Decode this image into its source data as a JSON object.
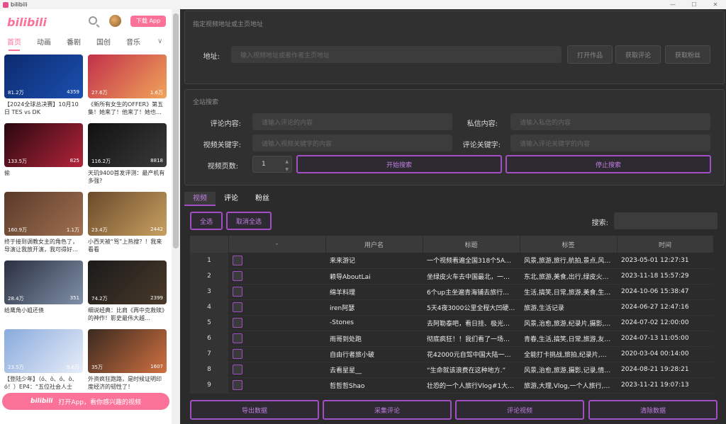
{
  "window": {
    "title": "bilibili",
    "controls": [
      "—",
      "☐",
      "✕"
    ]
  },
  "bili": {
    "logo": "bilibili",
    "download_btn": "下载 App",
    "tabs": [
      "首页",
      "动画",
      "番剧",
      "国创",
      "音乐"
    ],
    "cards": [
      {
        "title": "【2024全球总决赛】10月10日 TES vs DK",
        "views": "81.2万",
        "comments": "4359",
        "color1": "#0d2b6e",
        "color2": "#1b4fb0"
      },
      {
        "title": "《新所有女生的OFFER》第五集！她来了！他来了！她也…",
        "views": "27.6万",
        "comments": "1.6万",
        "color1": "#c2304a",
        "color2": "#f0a45a"
      },
      {
        "title": "偷",
        "views": "133.5万",
        "comments": "825",
        "color1": "#2a0810",
        "color2": "#b3243a"
      },
      {
        "title": "天玑9400首发评测：最产机有多强?",
        "views": "116.2万",
        "comments": "8818",
        "color1": "#111111",
        "color2": "#3a3a3a"
      },
      {
        "title": "终于接到调教女主的角色了，导演让我放开演，我可得好…",
        "views": "160.9万",
        "comments": "1.1万",
        "color1": "#5a3a2a",
        "color2": "#a07050"
      },
      {
        "title": "小西天被“骂”上热搜？！我来看看",
        "views": "23.4万",
        "comments": "2442",
        "color1": "#6a4a2a",
        "color2": "#c8a060"
      },
      {
        "title": "给鹰角小姐还债",
        "views": "28.4万",
        "comments": "351",
        "color1": "#2a3040",
        "color2": "#8090a8"
      },
      {
        "title": "细说经典：比肩《再中克救赎》的神作！影史最伟大越…",
        "views": "74.2万",
        "comments": "2399",
        "color1": "#1a1a1a",
        "color2": "#4a3a2a"
      },
      {
        "title": "【登陆少年】（ó、ò、ó、ò、ó！）EP4：“五位社会人士的…",
        "views": "23.5万",
        "comments": "9.6万",
        "color1": "#88aadd",
        "color2": "#e8eef8"
      },
      {
        "title": "外资疯狂跑路，是时候证明印度经济的韧性了！",
        "views": "35万",
        "comments": "1607",
        "color1": "#3a2a20",
        "color2": "#d07040"
      }
    ],
    "open_app": "打开App，看你感兴趣的视频"
  },
  "addr": {
    "group_title": "指定视频地址或主页地址",
    "label": "地址:",
    "placeholder": "输入视频地址或者作者主页地址",
    "buttons": [
      "打开作品",
      "获取评论",
      "获取粉丝"
    ]
  },
  "search": {
    "group_title": "全站搜索",
    "comment_label": "评论内容:",
    "comment_ph": "请输入评论的内容",
    "dm_label": "私信内容:",
    "dm_ph": "请输入私信的内容",
    "vkw_label": "视频关键字:",
    "vkw_ph": "请输入视频关键字的内容",
    "ckw_label": "评论关键字:",
    "ckw_ph": "请输入评论关键字的内容",
    "pages_label": "视频页数:",
    "pages_value": "1",
    "start_btn": "开始搜索",
    "stop_btn": "停止搜索"
  },
  "results": {
    "tabs": [
      "视频",
      "评论",
      "粉丝"
    ],
    "select_all": "全选",
    "deselect_all": "取消全选",
    "search_label": "搜索:",
    "columns": [
      "-",
      "用户名",
      "标题",
      "标签",
      "时间"
    ],
    "rows": [
      {
        "n": "1",
        "user": "来来游记",
        "title": "一个视频看遍全国318个5A…",
        "tags": "风景,旅游,旅行,航拍,景点,风…",
        "time": "2023-05-01 12:27:31"
      },
      {
        "n": "2",
        "user": "赖导AboutLai",
        "title": "坐绿皮火车去中国最北，一…",
        "tags": "东北,旅游,美食,出行,绿皮火…",
        "time": "2023-11-18 15:57:29"
      },
      {
        "n": "3",
        "user": "绵羊料理",
        "title": "6个up主坐遍青海铺去旅行…",
        "tags": "生活,搞笑,日常,旅游,美食,生…",
        "time": "2024-10-06 15:38:47"
      },
      {
        "n": "4",
        "user": "iren阿瑟",
        "title": "5天4夜3000公里全程大凹硬…",
        "tags": "旅游,生活记录",
        "time": "2024-06-27 12:47:16"
      },
      {
        "n": "5",
        "user": "-Stones",
        "title": "去阿勒泰吧，看日挂、极光…",
        "tags": "风景,治愈,旅游,纪录片,摄影,…",
        "time": "2024-07-02 12:00:00"
      },
      {
        "n": "6",
        "user": "雨哥到处跑",
        "title": "彻底疯狂！！我们看了一场…",
        "tags": "青春,生活,搞笑,日常,旅游,友…",
        "time": "2024-07-13 11:05:00"
      },
      {
        "n": "7",
        "user": "自由行者旅小破",
        "title": "花42000元自驾中国大陆一…",
        "tags": "全能打卡挑战,旅拍,纪录片,…",
        "time": "2020-03-04 00:14:00"
      },
      {
        "n": "8",
        "user": "去看星星__",
        "title": "“生命就该浪费在这种地方.”",
        "tags": "风景,治愈,旅游,摄影,记录,情…",
        "time": "2024-08-21 19:28:21"
      },
      {
        "n": "9",
        "user": "哲哲哲Shao",
        "title": "壮恐的一个人旅行Vlog#1大…",
        "tags": "旅游,大理,Vlog,一个人旅行,…",
        "time": "2023-11-21 19:07:13"
      }
    ],
    "bottom_buttons": [
      "导出数据",
      "采集评论",
      "评论视频",
      "清除数据"
    ]
  }
}
